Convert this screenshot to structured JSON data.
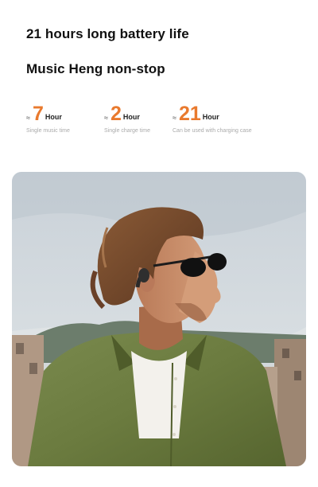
{
  "headline_1": "21 hours long battery life",
  "headline_2": "Music Heng non-stop",
  "stats": [
    {
      "approx": "≈",
      "value": "7",
      "unit": "Hour",
      "caption": "Single music time"
    },
    {
      "approx": "≈",
      "value": "2",
      "unit": "Hour",
      "caption": "Single charge time"
    },
    {
      "approx": "≈",
      "value": "21",
      "unit": "Hour",
      "caption": "Can be used with charging case"
    }
  ],
  "colors": {
    "accent": "#e97a2e",
    "headline": "#111111",
    "caption": "#aaaaaa"
  },
  "photo": {
    "subject": "man-wearing-bone-conduction-headphones-and-sunglasses"
  }
}
